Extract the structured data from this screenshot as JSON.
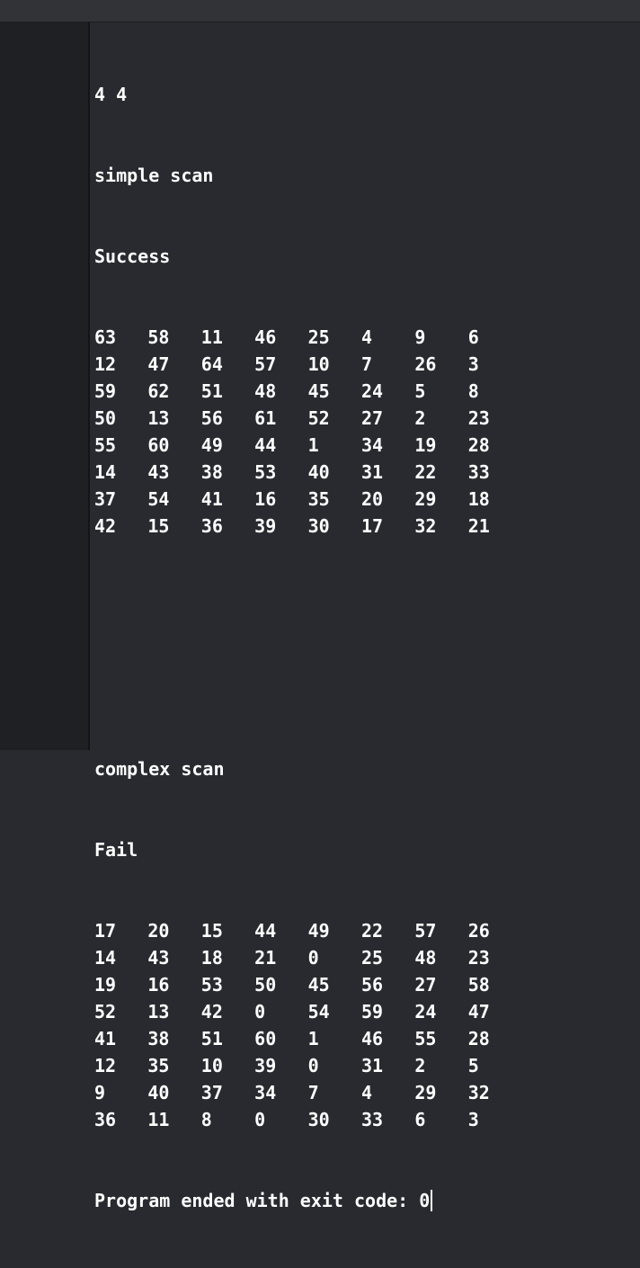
{
  "console": {
    "header_line": "4 4",
    "simple": {
      "title": "simple scan",
      "status": "Success",
      "rows": [
        [
          "63",
          "58",
          "11",
          "46",
          "25",
          "4",
          "9",
          "6"
        ],
        [
          "12",
          "47",
          "64",
          "57",
          "10",
          "7",
          "26",
          "3"
        ],
        [
          "59",
          "62",
          "51",
          "48",
          "45",
          "24",
          "5",
          "8"
        ],
        [
          "50",
          "13",
          "56",
          "61",
          "52",
          "27",
          "2",
          "23"
        ],
        [
          "55",
          "60",
          "49",
          "44",
          "1",
          "34",
          "19",
          "28"
        ],
        [
          "14",
          "43",
          "38",
          "53",
          "40",
          "31",
          "22",
          "33"
        ],
        [
          "37",
          "54",
          "41",
          "16",
          "35",
          "20",
          "29",
          "18"
        ],
        [
          "42",
          "15",
          "36",
          "39",
          "30",
          "17",
          "32",
          "21"
        ]
      ]
    },
    "complex": {
      "title": "complex scan",
      "status": "Fail",
      "rows": [
        [
          "17",
          "20",
          "15",
          "44",
          "49",
          "22",
          "57",
          "26"
        ],
        [
          "14",
          "43",
          "18",
          "21",
          "0",
          "25",
          "48",
          "23"
        ],
        [
          "19",
          "16",
          "53",
          "50",
          "45",
          "56",
          "27",
          "58"
        ],
        [
          "52",
          "13",
          "42",
          "0",
          "54",
          "59",
          "24",
          "47"
        ],
        [
          "41",
          "38",
          "51",
          "60",
          "1",
          "46",
          "55",
          "28"
        ],
        [
          "12",
          "35",
          "10",
          "39",
          "0",
          "31",
          "2",
          "5"
        ],
        [
          "9",
          "40",
          "37",
          "34",
          "7",
          "4",
          "29",
          "32"
        ],
        [
          "36",
          "11",
          "8",
          "0",
          "30",
          "33",
          "6",
          "3"
        ]
      ]
    },
    "footer_line": "Program ended with exit code: 0"
  }
}
